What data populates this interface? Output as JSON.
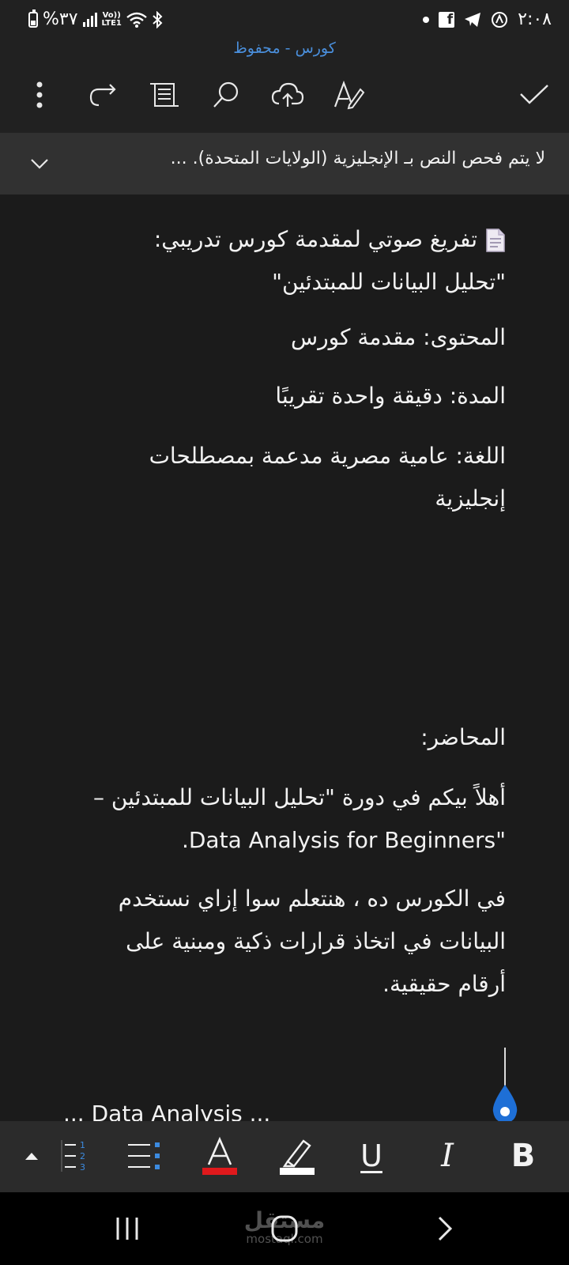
{
  "status_bar": {
    "battery": "%٣٧",
    "network": "LTE1",
    "volte": "Vo))",
    "time": "٢:٠٨"
  },
  "header": {
    "doc_title": "كورس - محفوظ"
  },
  "toolbar": {
    "icons": [
      "more-icon",
      "redo-icon",
      "document-view-icon",
      "search-icon",
      "cloud-upload-icon",
      "editor-pen-icon",
      "done-check-icon"
    ]
  },
  "proofing": {
    "message": "لا يتم فحص النص بـ الإنجليزية (الولايات المتحدة). ..."
  },
  "document": {
    "heading_line1": "تفريغ صوتي لمقدمة كورس تدريبي:",
    "heading_line2": "\"تحليل البيانات للمبتدئين\"",
    "content": "المحتوى: مقدمة كورس",
    "duration": "المدة: دقيقة واحدة تقريبًا",
    "language_line1": "اللغة: عامية مصرية مدعمة بمصطلحات",
    "language_line2": "إنجليزية",
    "lecturer": "المحاضر:",
    "welcome_line1": "أهلاً بيكم في دورة \"تحليل البيانات للمبتدئين –",
    "welcome_line2": "\"Data Analysis for Beginners.",
    "course_line1": "في الكورس ده ، هنتعلم سوا إزاي نستخدم",
    "course_line2": "البيانات في اتخاذ قرارات ذكية ومبنية على",
    "course_line3": "أرقام حقيقية.",
    "partial_line": "... Data Analysis ..."
  },
  "format_bar": {
    "underline_label": "U",
    "italic_label": "I",
    "bold_label": "B",
    "font_color": "#e0191c",
    "highlight_color": "#ffffff"
  },
  "nav_bar": {
    "watermark_ar": "مستقل",
    "watermark_en": "mostaql.com"
  },
  "colors": {
    "accent": "#4a8fdc",
    "background": "#1b1b1b",
    "caret_handle": "#1e6fd6"
  }
}
